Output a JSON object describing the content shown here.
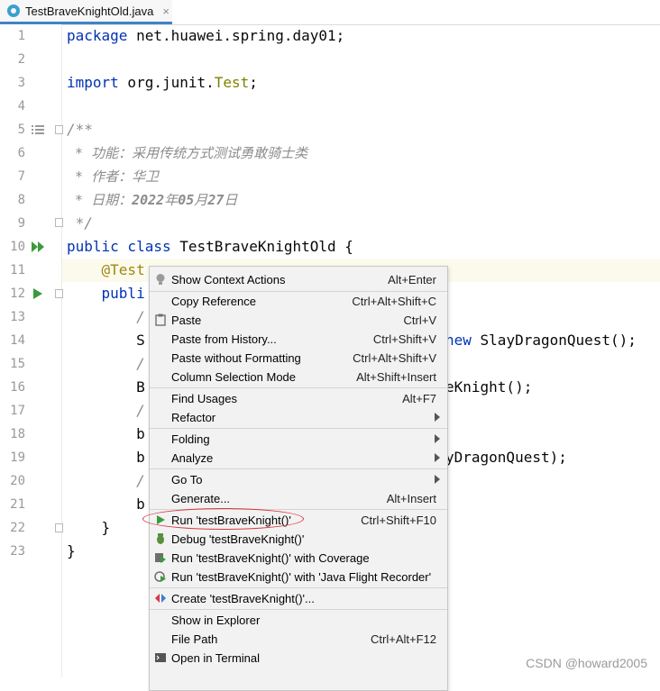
{
  "tab": {
    "title": "TestBraveKnightOld.java",
    "close": "×"
  },
  "line_numbers": [
    "1",
    "2",
    "3",
    "4",
    "5",
    "6",
    "7",
    "8",
    "9",
    "10",
    "11",
    "12",
    "13",
    "14",
    "15",
    "16",
    "17",
    "18",
    "19",
    "20",
    "21",
    "22",
    "23"
  ],
  "code": {
    "l1_kw": "package",
    "l1_rest": " net.huawei.spring.day01;",
    "l3_kw": "import",
    "l3_pkg": " org.junit.",
    "l3_cls": "Test",
    "l3_end": ";",
    "l5": "/**",
    "l6": " * 功能：采用传统方式测试勇敢骑士类",
    "l7": " * 作者：华卫",
    "l8_a": " * 日期：",
    "l8_b": "2022",
    "l8_c": "年",
    "l8_d": "05",
    "l8_e": "月",
    "l8_f": "27",
    "l8_g": "日",
    "l9": " */",
    "l10_kw": "public class",
    "l10_rest": " TestBraveKnightOld {",
    "l11": "    @Test",
    "l12": "    publi",
    "l13": "        /",
    "l14_a": "        S",
    "l14_b": "new",
    "l14_c": " SlayDragonQuest();",
    "l15": "        /",
    "l16_a": "        B",
    "l16_b": "eKnight();",
    "l17": "        /",
    "l18": "        b",
    "l19_a": "        b",
    "l19_b": "yDragonQuest);",
    "l20": "        /",
    "l21": "        b",
    "l22": "    }",
    "l23": "}"
  },
  "menu": {
    "items": [
      {
        "label": "Show Context Actions",
        "shortcut": "Alt+Enter"
      },
      {
        "label": "Copy Reference",
        "shortcut": "Ctrl+Alt+Shift+C"
      },
      {
        "label": "Paste",
        "shortcut": "Ctrl+V"
      },
      {
        "label": "Paste from History...",
        "shortcut": "Ctrl+Shift+V"
      },
      {
        "label": "Paste without Formatting",
        "shortcut": "Ctrl+Alt+Shift+V"
      },
      {
        "label": "Column Selection Mode",
        "shortcut": "Alt+Shift+Insert"
      },
      {
        "label": "Find Usages",
        "shortcut": "Alt+F7"
      },
      {
        "label": "Refactor",
        "shortcut": ""
      },
      {
        "label": "Folding",
        "shortcut": ""
      },
      {
        "label": "Analyze",
        "shortcut": ""
      },
      {
        "label": "Go To",
        "shortcut": ""
      },
      {
        "label": "Generate...",
        "shortcut": "Alt+Insert"
      },
      {
        "label": "Run 'testBraveKnight()'",
        "shortcut": "Ctrl+Shift+F10"
      },
      {
        "label": "Debug 'testBraveKnight()'",
        "shortcut": ""
      },
      {
        "label": "Run 'testBraveKnight()' with Coverage",
        "shortcut": ""
      },
      {
        "label": "Run 'testBraveKnight()' with 'Java Flight Recorder'",
        "shortcut": ""
      },
      {
        "label": "Create 'testBraveKnight()'...",
        "shortcut": ""
      },
      {
        "label": "Show in Explorer",
        "shortcut": ""
      },
      {
        "label": "File Path",
        "shortcut": "Ctrl+Alt+F12"
      },
      {
        "label": "Open in Terminal",
        "shortcut": ""
      }
    ],
    "icons": [
      "bulb-icon",
      "clipboard-icon",
      "run-icon",
      "debug-icon",
      "coverage-icon",
      "profiler-icon",
      "create-icon"
    ]
  },
  "watermark": "CSDN @howard2005",
  "colors": {
    "keyword": "#0033b3",
    "comment": "#8c8c8c",
    "annotation": "#9e880d",
    "run_green": "#3c9a3c",
    "highlight_oval": "#d9363e"
  }
}
